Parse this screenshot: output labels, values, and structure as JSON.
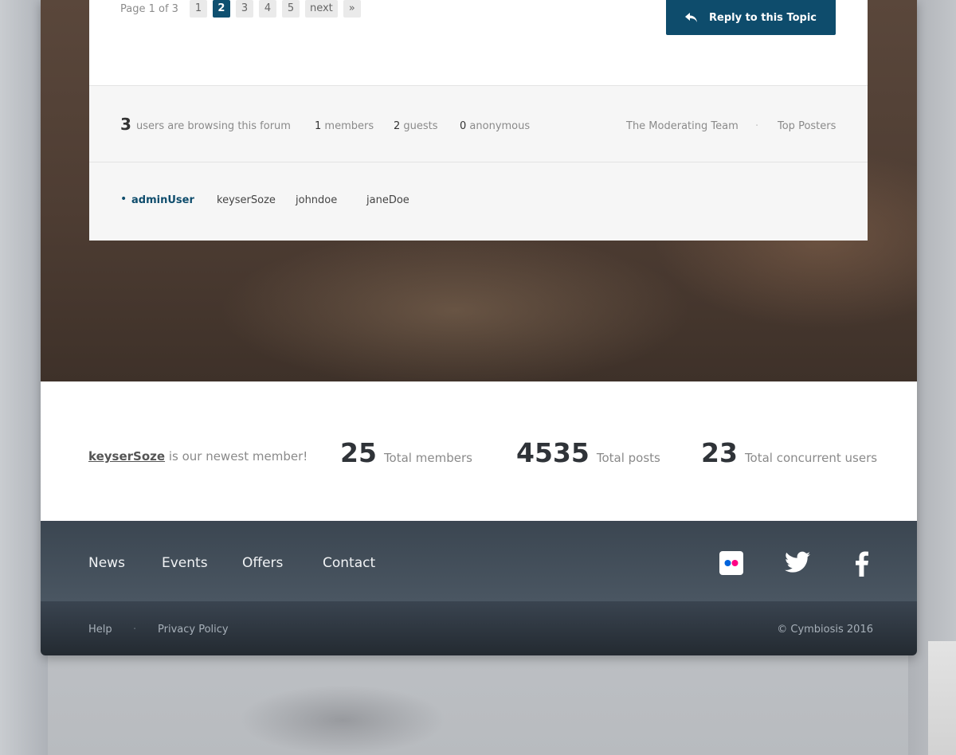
{
  "pagination": {
    "label": "Page 1 of 3",
    "pages": [
      "1",
      "2",
      "3",
      "4",
      "5"
    ],
    "active_page": "2",
    "next_label": "next",
    "last_label": "»"
  },
  "reply_button": {
    "label": "Reply to this Topic",
    "icon": "reply-icon"
  },
  "browsing": {
    "count": "3",
    "text": "users are browsing this forum",
    "members_count": "1",
    "members_label": "members",
    "guests_count": "2",
    "guests_label": "guests",
    "anonymous_count": "0",
    "anonymous_label": "anonymous",
    "links": [
      "The Moderating Team",
      "Top Posters"
    ],
    "separator": "·"
  },
  "online_users": {
    "bullet": "•",
    "names": [
      "adminUser",
      "keyserSoze",
      "johndoe",
      "janeDoe"
    ]
  },
  "stats": {
    "newest_member": "keyserSoze",
    "newest_text": "is our newest member!",
    "items": [
      {
        "value": "25",
        "label": "Total members"
      },
      {
        "value": "4535",
        "label": "Total posts"
      },
      {
        "value": "23",
        "label": "Total concurrent users"
      }
    ]
  },
  "footer": {
    "nav": [
      "News",
      "Events",
      "Offers",
      "Contact"
    ],
    "social": [
      "flickr-icon",
      "twitter-icon",
      "facebook-icon"
    ],
    "links": [
      "Help",
      "Privacy Policy"
    ],
    "separator": "·",
    "copyright": "© Cymbiosis 2016"
  },
  "colors": {
    "accent": "#0e4c6c",
    "footer": "#3b4651"
  }
}
